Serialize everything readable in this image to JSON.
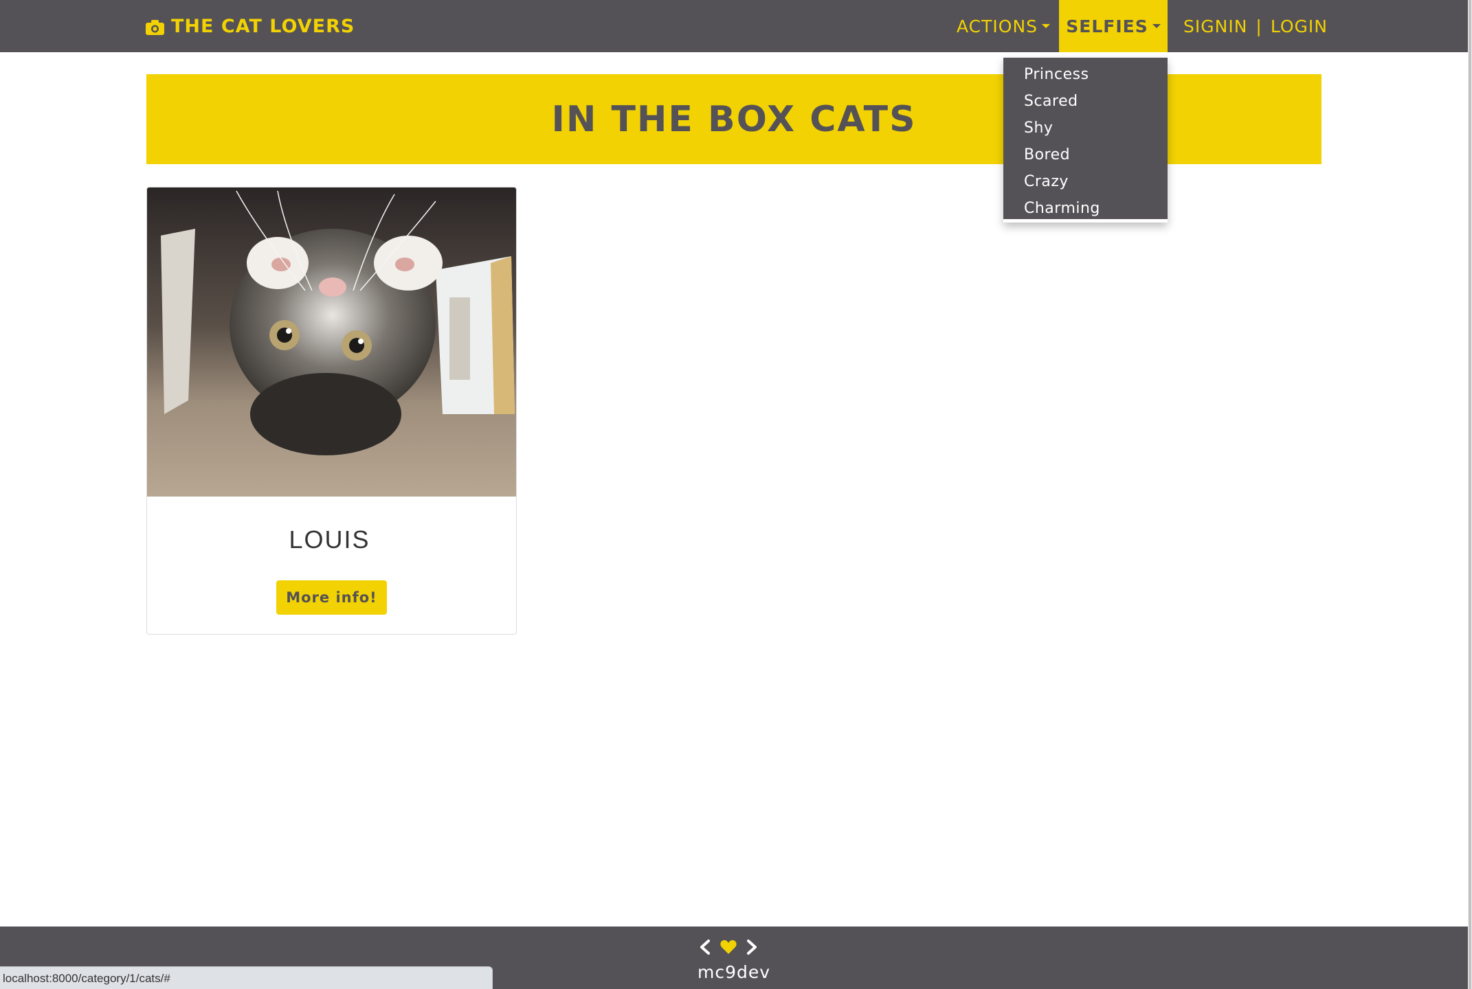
{
  "colors": {
    "accent": "#f2d203",
    "nav_bg": "#545256",
    "text_dark": "#545256",
    "white": "#ffffff"
  },
  "navbar": {
    "brand_icon": "camera-icon",
    "brand": "THE CAT LOVERS",
    "actions_label": "ACTIONS",
    "selfies_label": "SELFIES",
    "signin_label": "SIGNIN",
    "separator": "|",
    "login_label": "LOGIN"
  },
  "selfies_menu": {
    "items": [
      "Princess",
      "Scared",
      "Shy",
      "Bored",
      "Crazy",
      "Charming"
    ]
  },
  "header": {
    "title": "IN THE BOX CATS"
  },
  "cards": [
    {
      "name": "LOUIS",
      "button_label": "More info!",
      "image": "kitten-in-box-photo"
    }
  ],
  "footer": {
    "icons": [
      "chevron-left-icon",
      "heart-icon",
      "chevron-right-icon"
    ],
    "username": "mc9dev"
  },
  "statusbar": {
    "url": "localhost:8000/category/1/cats/#"
  }
}
